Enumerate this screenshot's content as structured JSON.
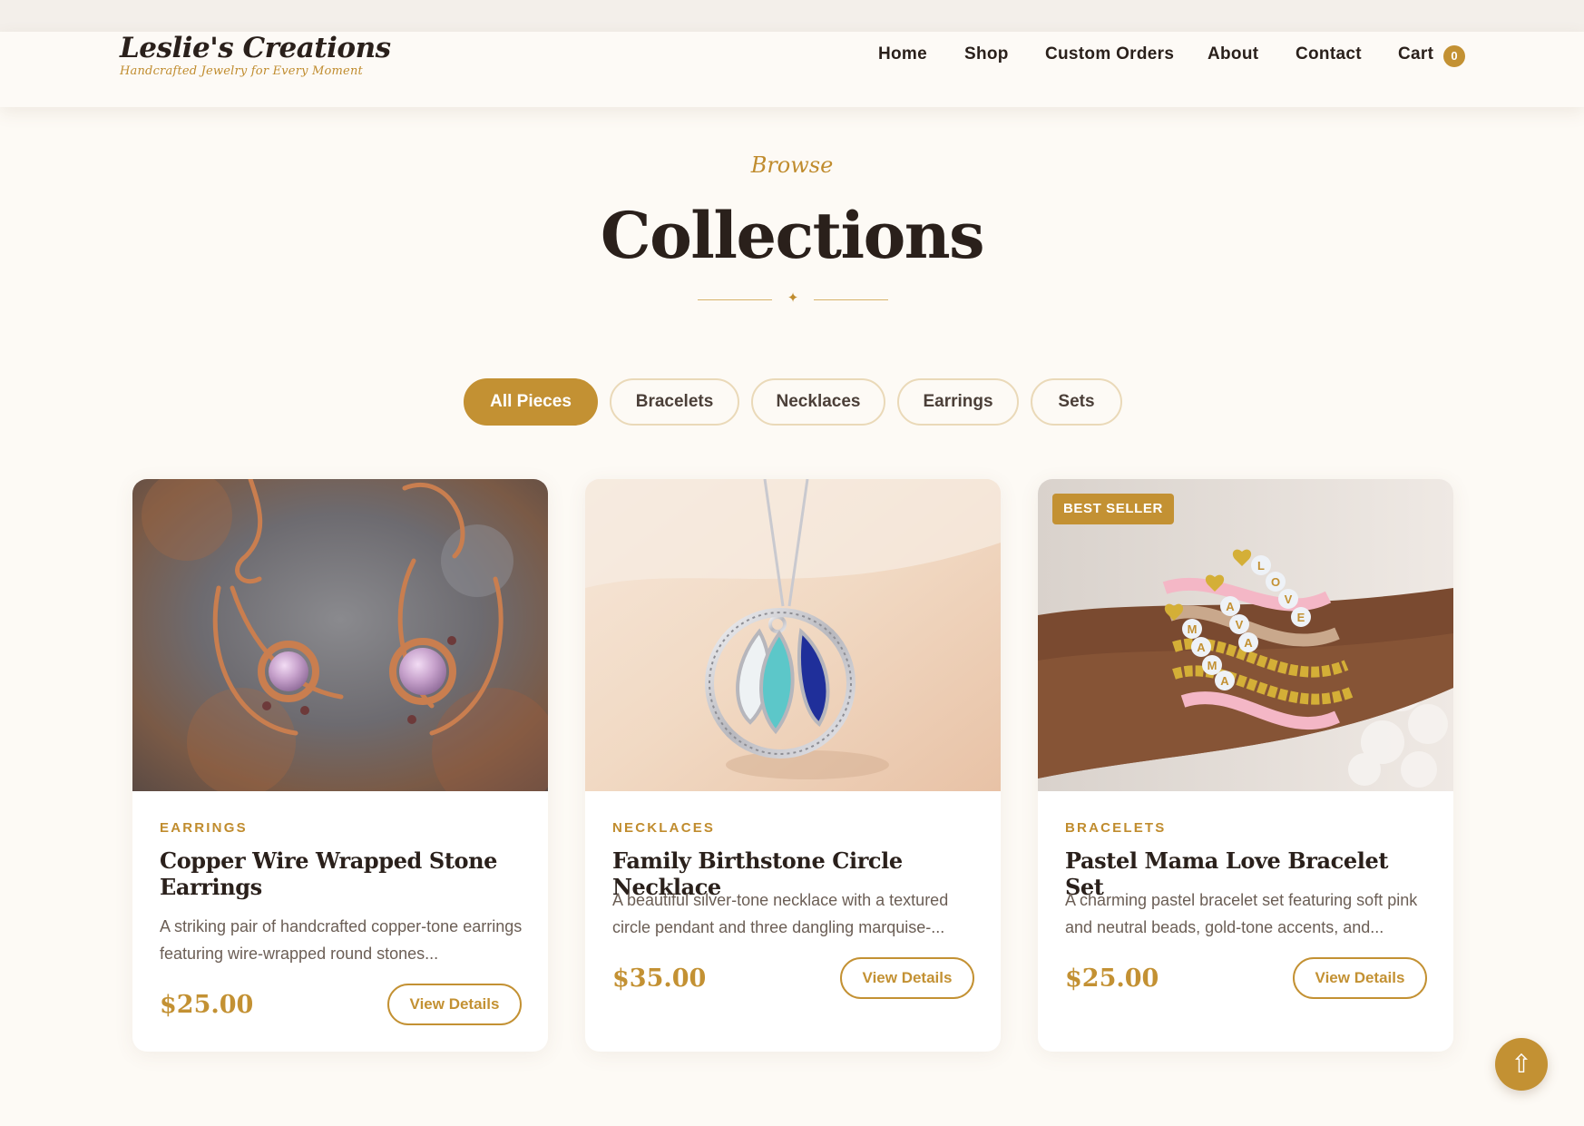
{
  "brand": {
    "name": "Leslie's Creations",
    "tagline": "Handcrafted Jewelry for Every Moment"
  },
  "nav": {
    "items": [
      "Home",
      "Shop",
      "Custom Orders",
      "About",
      "Contact",
      "Cart"
    ],
    "cart_count": "0"
  },
  "section": {
    "eyebrow": "Browse",
    "title": "Collections",
    "divider_icon": "sparkle-icon"
  },
  "filters": {
    "active": "All Pieces",
    "items": [
      "All Pieces",
      "Bracelets",
      "Necklaces",
      "Earrings",
      "Sets"
    ]
  },
  "products": [
    {
      "category": "EARRINGS",
      "title": "Copper Wire Wrapped Stone Earrings",
      "description": "A striking pair of handcrafted copper-tone earrings featuring wire-wrapped round stones...",
      "price": "$25.00",
      "button": "View Details",
      "badge": ""
    },
    {
      "category": "NECKLACES",
      "title": "Family Birthstone Circle Necklace",
      "description": "A beautiful silver-tone necklace with a textured circle pendant and three dangling marquise-...",
      "price": "$35.00",
      "button": "View Details",
      "badge": ""
    },
    {
      "category": "BRACELETS",
      "title": "Pastel Mama Love Bracelet Set",
      "description": "A charming pastel bracelet set featuring soft pink and neutral beads, gold-tone accents, and...",
      "price": "$25.00",
      "button": "View Details",
      "badge": "BEST SELLER"
    }
  ],
  "bracelet_letters": {
    "row1": [
      "L",
      "O",
      "V",
      "E"
    ],
    "row2": [
      "A",
      "V",
      "A"
    ],
    "row3": [
      "M",
      "A",
      "M",
      "A"
    ]
  },
  "scroll_top_icon": "arrow-up-icon",
  "colors": {
    "accent": "#c39133",
    "background": "#fdfaf5",
    "text": "#2a201b"
  }
}
